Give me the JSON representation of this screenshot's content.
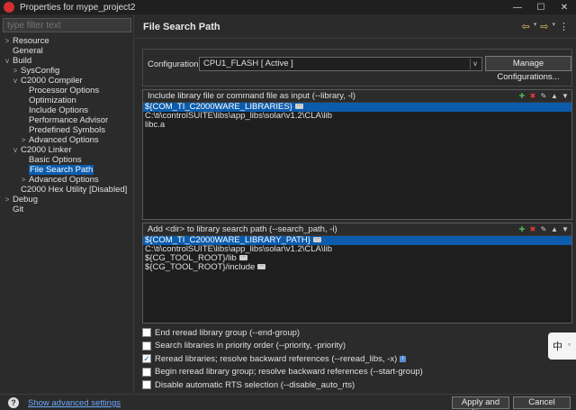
{
  "window": {
    "title": "Properties for mype_project2",
    "controls": [
      "—",
      "☐",
      "✕"
    ]
  },
  "sidebar": {
    "filter_placeholder": "type filter text",
    "items": [
      {
        "label": "Resource",
        "level": 0,
        "toggle": ">"
      },
      {
        "label": "General",
        "level": 0,
        "toggle": ""
      },
      {
        "label": "Build",
        "level": 0,
        "toggle": "v"
      },
      {
        "label": "SysConfig",
        "level": 1,
        "toggle": ">"
      },
      {
        "label": "C2000 Compiler",
        "level": 1,
        "toggle": "v"
      },
      {
        "label": "Processor Options",
        "level": 2,
        "toggle": ""
      },
      {
        "label": "Optimization",
        "level": 2,
        "toggle": ""
      },
      {
        "label": "Include Options",
        "level": 2,
        "toggle": ""
      },
      {
        "label": "Performance Advisor",
        "level": 2,
        "toggle": ""
      },
      {
        "label": "Predefined Symbols",
        "level": 2,
        "toggle": ""
      },
      {
        "label": "Advanced Options",
        "level": 2,
        "toggle": ">"
      },
      {
        "label": "C2000 Linker",
        "level": 1,
        "toggle": "v"
      },
      {
        "label": "Basic Options",
        "level": 2,
        "toggle": ""
      },
      {
        "label": "File Search Path",
        "level": 2,
        "toggle": "",
        "selected": true
      },
      {
        "label": "Advanced Options",
        "level": 2,
        "toggle": ">"
      },
      {
        "label": "C2000 Hex Utility  [Disabled]",
        "level": 1,
        "toggle": ""
      },
      {
        "label": "Debug",
        "level": 0,
        "toggle": ">"
      },
      {
        "label": "Git",
        "level": 0,
        "toggle": ""
      }
    ]
  },
  "main": {
    "title": "File Search Path",
    "configuration": {
      "label": "Configuration:",
      "value": "CPU1_FLASH  [ Active ]",
      "manage_label": "Manage Configurations..."
    },
    "library_list": {
      "header": "Include library file or command file as input (--library, -l)",
      "rows": [
        {
          "text": "${COM_TI_C2000WARE_LIBRARIES}",
          "selected": true,
          "has_dots": true
        },
        {
          "text": "C:\\ti\\controlSUITE\\libs\\app_libs\\solar\\v1.2\\CLA\\lib",
          "selected": false,
          "has_dots": false
        },
        {
          "text": "libc.a",
          "selected": false,
          "has_dots": false
        }
      ]
    },
    "search_path_list": {
      "header": "Add <dir> to library search path (--search_path, -i)",
      "rows": [
        {
          "text": "${COM_TI_C2000WARE_LIBRARY_PATH}",
          "selected": true,
          "has_dots": true
        },
        {
          "text": "C:\\ti\\controlSUITE\\libs\\app_libs\\solar\\v1.2\\CLA\\lib",
          "selected": false,
          "has_dots": false
        },
        {
          "text": "${CG_TOOL_ROOT}/lib",
          "selected": false,
          "has_dots": true
        },
        {
          "text": "${CG_TOOL_ROOT}/include",
          "selected": false,
          "has_dots": true
        }
      ]
    },
    "options": [
      {
        "label": "End reread library group (--end-group)",
        "checked": false
      },
      {
        "label": "Search libraries in priority order (--priority, -priority)",
        "checked": false
      },
      {
        "label": "Reread libraries; resolve backward references (--reread_libs, -x)",
        "checked": true
      },
      {
        "label": "Begin reread library group; resolve backward references (--start-group)",
        "checked": false
      },
      {
        "label": "Disable automatic RTS selection (--disable_auto_rts)",
        "checked": false
      }
    ]
  },
  "ime": {
    "text": "中"
  },
  "footer": {
    "help_glyph": "?",
    "advanced_link": "Show advanced settings",
    "apply_label": "Apply and Close",
    "cancel_label": "Cancel"
  }
}
